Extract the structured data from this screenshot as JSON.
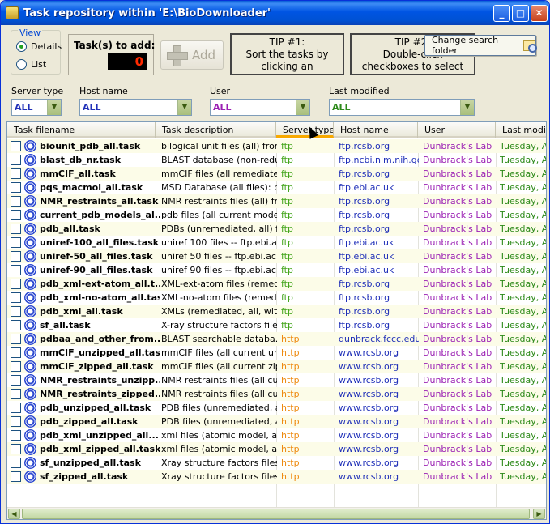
{
  "window": {
    "title": "Task repository within 'E:\\BioDownloader'",
    "minimize_glyph": "_",
    "maximize_glyph": "□",
    "close_glyph": "✕"
  },
  "view": {
    "group_label": "View",
    "details_label": "Details",
    "list_label": "List",
    "selected": "Details"
  },
  "tasks_to_add": {
    "label": "Task(s) to add:",
    "count": "0"
  },
  "add_button": {
    "label": "Add",
    "enabled": false
  },
  "tips": {
    "tip1": "TIP #1:\nSort the tasks by clicking an appropriate column",
    "tip2": "TIP #2:\nDouble-click\ncheckboxes to select tasks"
  },
  "change_search_folder": {
    "label": "Change search folder"
  },
  "filters": {
    "server_type": {
      "label": "Server type",
      "value": "ALL",
      "color": "#1f2fb8"
    },
    "host_name": {
      "label": "Host name",
      "value": "ALL",
      "color": "#1f2fb8"
    },
    "user": {
      "label": "User",
      "value": "ALL",
      "color": "#9a1fb3"
    },
    "last_modified": {
      "label": "Last modified",
      "value": "ALL",
      "color": "#2d8a1a"
    }
  },
  "grid": {
    "columns": [
      "Task filename",
      "Task description",
      "Server type",
      "Host name",
      "User",
      "Last modifie"
    ],
    "sorted_column": "Server type",
    "rows": [
      {
        "file": "biounit_pdb_all.task",
        "desc": "bilogical unit files (all) from ...",
        "server": "ftp",
        "host": "ftp.rcsb.org",
        "user": "Dunbrack's Lab",
        "mod": "Tuesday, Au"
      },
      {
        "file": "blast_db_nr.task",
        "desc": "BLAST database (non-redun...",
        "server": "ftp",
        "host": "ftp.ncbi.nlm.nih.gov",
        "user": "Dunbrack's Lab",
        "mod": "Tuesday, Au"
      },
      {
        "file": "mmCIF_all.task",
        "desc": "mmCIF files (all remediated ...",
        "server": "ftp",
        "host": "ftp.rcsb.org",
        "user": "Dunbrack's Lab",
        "mod": "Tuesday, Au"
      },
      {
        "file": "pqs_macmol_all.task",
        "desc": "MSD Database (all files): p...",
        "server": "ftp",
        "host": "ftp.ebi.ac.uk",
        "user": "Dunbrack's Lab",
        "mod": "Tuesday, Au"
      },
      {
        "file": "NMR_restraints_all.task",
        "desc": "NMR restraints files (all) fro...",
        "server": "ftp",
        "host": "ftp.rcsb.org",
        "user": "Dunbrack's Lab",
        "mod": "Tuesday, Au"
      },
      {
        "file": "current_pdb_models_al...",
        "desc": "pdb files (all current model...",
        "server": "ftp",
        "host": "ftp.rcsb.org",
        "user": "Dunbrack's Lab",
        "mod": "Tuesday, Au"
      },
      {
        "file": "pdb_all.task",
        "desc": "PDBs (unremediated, all) fr...",
        "server": "ftp",
        "host": "ftp.rcsb.org",
        "user": "Dunbrack's Lab",
        "mod": "Tuesday, Au"
      },
      {
        "file": "uniref-100_all_files.task",
        "desc": "uniref 100 files -- ftp.ebi.ac...",
        "server": "ftp",
        "host": "ftp.ebi.ac.uk",
        "user": "Dunbrack's Lab",
        "mod": "Tuesday, Au"
      },
      {
        "file": "uniref-50_all_files.task",
        "desc": "uniref 50 files -- ftp.ebi.ac.uk",
        "server": "ftp",
        "host": "ftp.ebi.ac.uk",
        "user": "Dunbrack's Lab",
        "mod": "Tuesday, Au"
      },
      {
        "file": "uniref-90_all_files.task",
        "desc": "uniref 90 files -- ftp.ebi.ac.uk",
        "server": "ftp",
        "host": "ftp.ebi.ac.uk",
        "user": "Dunbrack's Lab",
        "mod": "Tuesday, Au"
      },
      {
        "file": "pdb_xml-ext-atom_all.t...",
        "desc": "XML-ext-atom files (remedi...",
        "server": "ftp",
        "host": "ftp.rcsb.org",
        "user": "Dunbrack's Lab",
        "mod": "Tuesday, Au"
      },
      {
        "file": "pdb_xml-no-atom_all.task",
        "desc": "XML-no-atom files (remedi...",
        "server": "ftp",
        "host": "ftp.rcsb.org",
        "user": "Dunbrack's Lab",
        "mod": "Tuesday, Au"
      },
      {
        "file": "pdb_xml_all.task",
        "desc": "XMLs (remediated, all, with...",
        "server": "ftp",
        "host": "ftp.rcsb.org",
        "user": "Dunbrack's Lab",
        "mod": "Tuesday, Au"
      },
      {
        "file": "sf_all.task",
        "desc": "X-ray structure factors files...",
        "server": "ftp",
        "host": "ftp.rcsb.org",
        "user": "Dunbrack's Lab",
        "mod": "Tuesday, Au"
      },
      {
        "file": "pdbaa_and_other_from...",
        "desc": "BLAST searchable databa...",
        "server": "http",
        "host": "dunbrack.fccc.edu",
        "user": "Dunbrack's Lab",
        "mod": "Tuesday, Au"
      },
      {
        "file": "mmCIF_unzipped_all.task",
        "desc": "mmCIF files (all current unz...",
        "server": "http",
        "host": "www.rcsb.org",
        "user": "Dunbrack's Lab",
        "mod": "Tuesday, Au"
      },
      {
        "file": "mmCIF_zipped_all.task",
        "desc": "mmCIF files (all current zip...",
        "server": "http",
        "host": "www.rcsb.org",
        "user": "Dunbrack's Lab",
        "mod": "Tuesday, Au"
      },
      {
        "file": "NMR_restraints_unzipp...",
        "desc": "NMR restraints files (all cur...",
        "server": "http",
        "host": "www.rcsb.org",
        "user": "Dunbrack's Lab",
        "mod": "Tuesday, Au"
      },
      {
        "file": "NMR_restraints_zipped...",
        "desc": "NMR restraints files (all cur...",
        "server": "http",
        "host": "www.rcsb.org",
        "user": "Dunbrack's Lab",
        "mod": "Tuesday, Au"
      },
      {
        "file": "pdb_unzipped_all.task",
        "desc": "PDB files (unremediated, a...",
        "server": "http",
        "host": "www.rcsb.org",
        "user": "Dunbrack's Lab",
        "mod": "Tuesday, Au"
      },
      {
        "file": "pdb_zipped_all.task",
        "desc": "PDB files (unremediated, a...",
        "server": "http",
        "host": "www.rcsb.org",
        "user": "Dunbrack's Lab",
        "mod": "Tuesday, Au"
      },
      {
        "file": "pdb_xml_unzipped_all....",
        "desc": "xml files (atomic model, all ...",
        "server": "http",
        "host": "www.rcsb.org",
        "user": "Dunbrack's Lab",
        "mod": "Tuesday, Au"
      },
      {
        "file": "pdb_xml_zipped_all.task",
        "desc": "xml files (atomic model, all ...",
        "server": "http",
        "host": "www.rcsb.org",
        "user": "Dunbrack's Lab",
        "mod": "Tuesday, Au"
      },
      {
        "file": "sf_unzipped_all.task",
        "desc": "Xray structure factors files ...",
        "server": "http",
        "host": "www.rcsb.org",
        "user": "Dunbrack's Lab",
        "mod": "Tuesday, Au"
      },
      {
        "file": "sf_zipped_all.task",
        "desc": "Xray structure factors files ...",
        "server": "http",
        "host": "www.rcsb.org",
        "user": "Dunbrack's Lab",
        "mod": "Tuesday, Au"
      }
    ]
  },
  "colors": {
    "ftp": "#44a51c",
    "http": "#ee8a10",
    "host": "#1f2fb8",
    "user": "#9a1fb3",
    "modified": "#2d8a1a",
    "title_bar": "#0054e3"
  }
}
